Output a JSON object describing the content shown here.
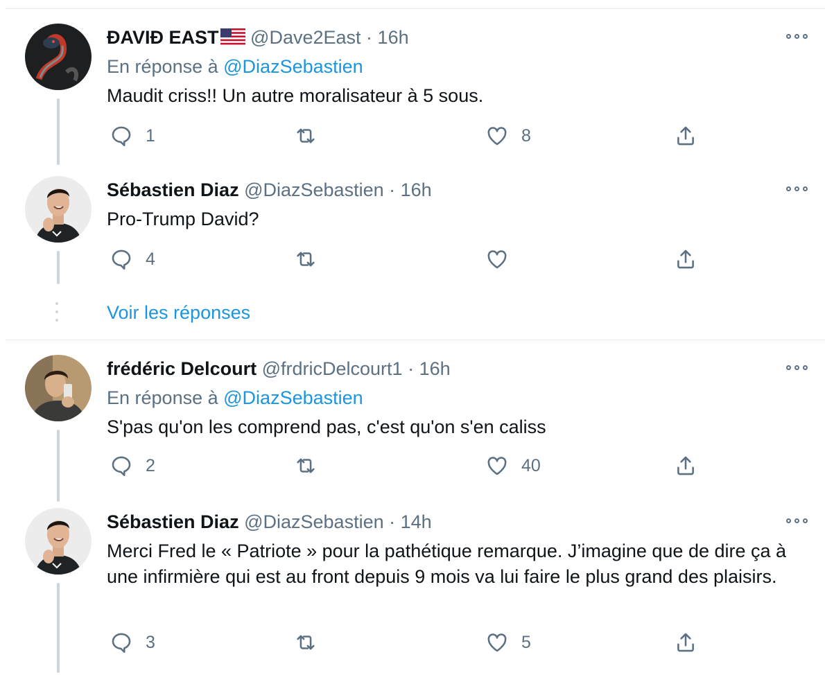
{
  "reply_prefix": "En réponse à",
  "show_replies": "Voir les réponses",
  "tweets": [
    {
      "name": "ĐAVIĐ EAST",
      "handle": "@Dave2East",
      "sep": "·",
      "time": "16h",
      "reply_to": "@DiazSebastien",
      "text": "Maudit criss!! Un autre moralisateur à 5 sous.",
      "replies": "1",
      "retweets": "",
      "likes": "8"
    },
    {
      "name": "Sébastien Diaz",
      "handle": "@DiazSebastien",
      "sep": "·",
      "time": "16h",
      "text": "Pro-Trump David?",
      "replies": "4",
      "retweets": "",
      "likes": ""
    },
    {
      "name": "frédéric Delcourt",
      "handle": "@frdricDelcourt1",
      "sep": "·",
      "time": "16h",
      "reply_to": "@DiazSebastien",
      "text": "S'pas qu'on les comprend pas, c'est qu'on s'en caliss",
      "replies": "2",
      "retweets": "",
      "likes": "40"
    },
    {
      "name": "Sébastien Diaz",
      "handle": "@DiazSebastien",
      "sep": "·",
      "time": "14h",
      "text": "Merci Fred le « Patriote » pour la pathétique remarque. J’imagine que de dire ça à une infirmière qui est au front depuis 9 mois va lui faire le plus grand des plaisirs.",
      "replies": "3",
      "retweets": "",
      "likes": "5"
    }
  ],
  "colors": {
    "name": "#0f1419",
    "secondary": "#5b7083",
    "link": "#1b95e0",
    "thread": "#ccd6dd"
  },
  "icons": {
    "reply": "reply-icon",
    "retweet": "retweet-icon",
    "like": "heart-icon",
    "share": "share-icon",
    "more": "more-icon"
  }
}
